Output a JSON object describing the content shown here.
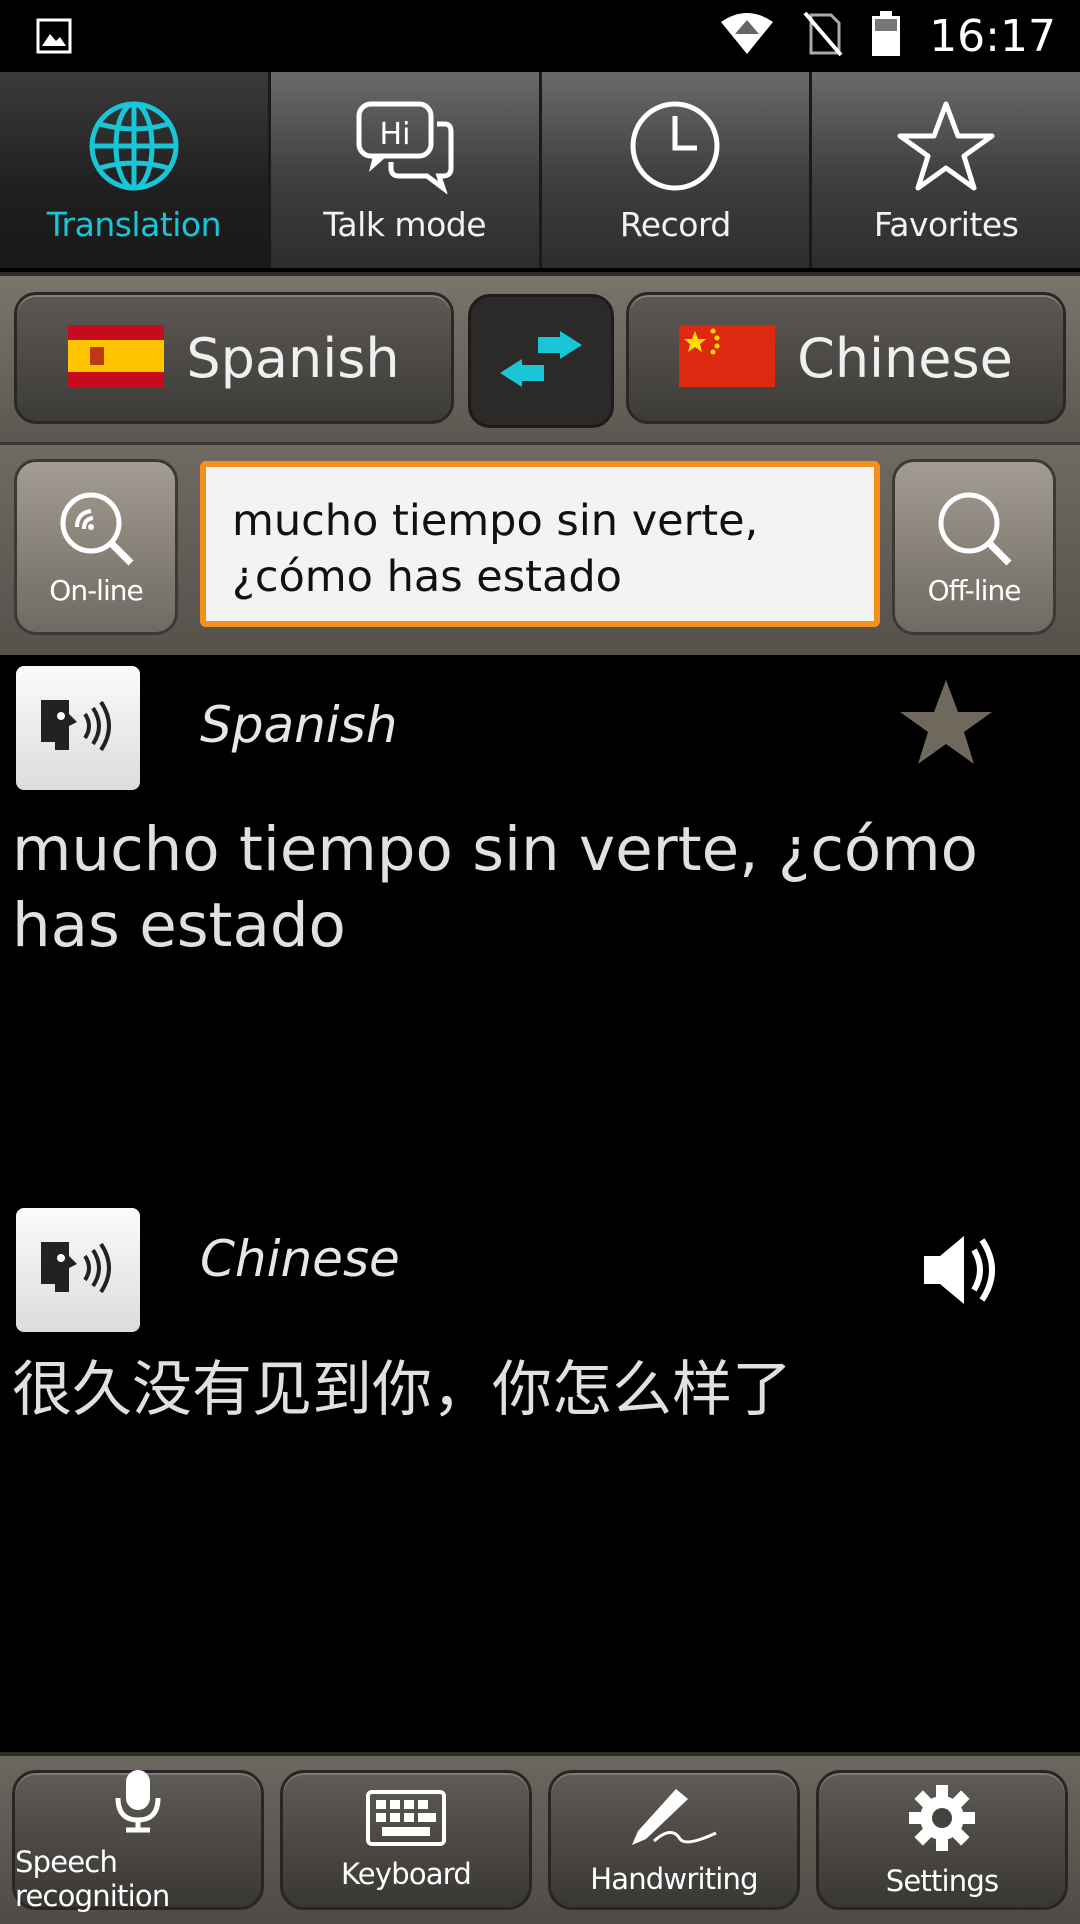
{
  "status_bar": {
    "time": "16:17",
    "icons": [
      "image-icon",
      "wifi-icon",
      "no-sim-icon",
      "battery-icon"
    ]
  },
  "tabs": [
    {
      "label": "Translation",
      "icon": "globe-icon",
      "active": true
    },
    {
      "label": "Talk mode",
      "icon": "chat-bubbles-icon",
      "active": false
    },
    {
      "label": "Record",
      "icon": "clock-icon",
      "active": false
    },
    {
      "label": "Favorites",
      "icon": "star-outline-icon",
      "active": false
    }
  ],
  "languages": {
    "source": {
      "name": "Spanish",
      "flag": "spain-flag-icon"
    },
    "target": {
      "name": "Chinese",
      "flag": "china-flag-icon"
    },
    "swap_icon": "swap-arrows-icon"
  },
  "search": {
    "online_label": "On-line",
    "offline_label": "Off-line",
    "input_value": "mucho tiempo sin verte, ¿cómo has estado"
  },
  "source_result": {
    "language": "Spanish",
    "text": "mucho tiempo sin verte, ¿cómo has estado"
  },
  "target_result": {
    "language": "Chinese",
    "text": "很久没有见到你，你怎么样了"
  },
  "bottom_bar": [
    {
      "label": "Speech recognition",
      "icon": "microphone-icon"
    },
    {
      "label": "Keyboard",
      "icon": "keyboard-icon"
    },
    {
      "label": "Handwriting",
      "icon": "pen-icon"
    },
    {
      "label": "Settings",
      "icon": "gear-icon"
    }
  ],
  "colors": {
    "accent": "#19c6d8",
    "input_border": "#f5901f",
    "background": "#000000"
  }
}
